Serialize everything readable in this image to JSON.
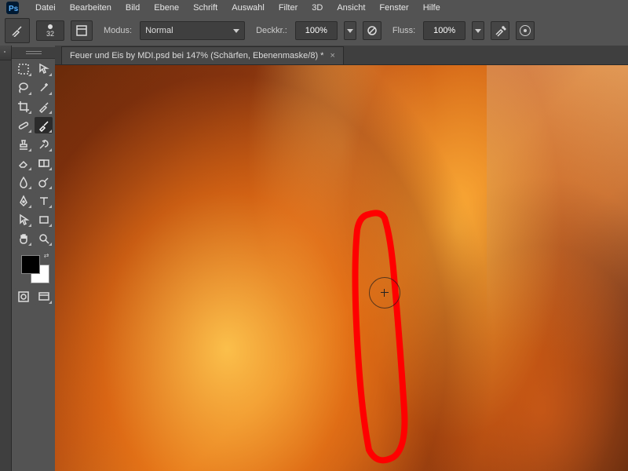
{
  "menu": {
    "items": [
      "Datei",
      "Bearbeiten",
      "Bild",
      "Ebene",
      "Schrift",
      "Auswahl",
      "Filter",
      "3D",
      "Ansicht",
      "Fenster",
      "Hilfe"
    ]
  },
  "options": {
    "brush_size": "32",
    "mode_label": "Modus:",
    "mode_value": "Normal",
    "opacity_label": "Deckkr.:",
    "opacity_value": "100%",
    "flow_label": "Fluss:",
    "flow_value": "100%"
  },
  "tab": {
    "title": "Feuer und Eis by MDI.psd bei 147% (Schärfen, Ebenenmaske/8) *",
    "close": "×"
  },
  "tools": {
    "row1": [
      "move",
      "marquee"
    ],
    "row2": [
      "lasso",
      "wand"
    ],
    "row3": [
      "crop",
      "eyedrop"
    ],
    "row4": [
      "heal",
      "brush"
    ],
    "row5": [
      "stamp",
      "history"
    ],
    "row6": [
      "eraser",
      "gradient"
    ],
    "row7": [
      "blur",
      "dodge"
    ],
    "row8": [
      "pen",
      "type"
    ],
    "row9": [
      "path",
      "shape"
    ],
    "row10": [
      "hand",
      "zoom"
    ],
    "mini": [
      "quickmask",
      "screen"
    ]
  }
}
